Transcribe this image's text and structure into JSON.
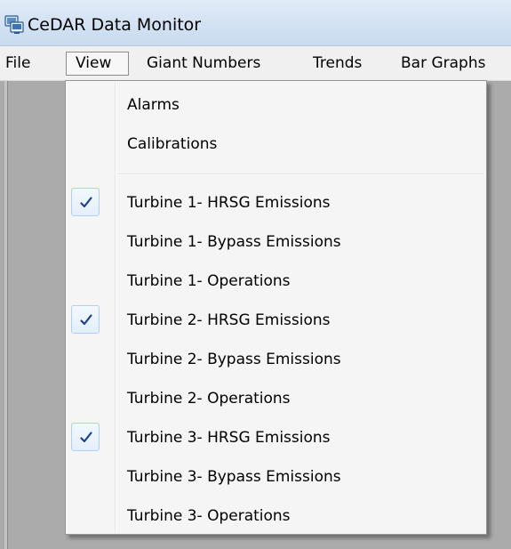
{
  "window": {
    "title": "CeDAR Data Monitor",
    "icon": "app-monitor-icon"
  },
  "menubar": {
    "items": [
      {
        "label": "File"
      },
      {
        "label": "View",
        "open": true
      },
      {
        "label": "Giant Numbers"
      },
      {
        "label": "Trends"
      },
      {
        "label": "Bar Graphs"
      }
    ]
  },
  "view_menu": {
    "group1": [
      {
        "label": "Alarms"
      },
      {
        "label": "Calibrations"
      }
    ],
    "group2": [
      {
        "label": "Turbine 1- HRSG Emissions",
        "checked": true
      },
      {
        "label": "Turbine 1- Bypass Emissions",
        "checked": false
      },
      {
        "label": "Turbine 1- Operations",
        "checked": false
      },
      {
        "label": "Turbine 2- HRSG Emissions",
        "checked": true
      },
      {
        "label": "Turbine 2- Bypass Emissions",
        "checked": false
      },
      {
        "label": "Turbine 2- Operations",
        "checked": false
      },
      {
        "label": "Turbine 3- HRSG Emissions",
        "checked": true
      },
      {
        "label": "Turbine 3- Bypass Emissions",
        "checked": false
      },
      {
        "label": "Turbine 3- Operations",
        "checked": false
      }
    ]
  },
  "colors": {
    "check_mark": "#1e3f8c",
    "check_border": "#aecff7",
    "client_background": "#ababab",
    "menu_background": "#f5f5f5"
  }
}
